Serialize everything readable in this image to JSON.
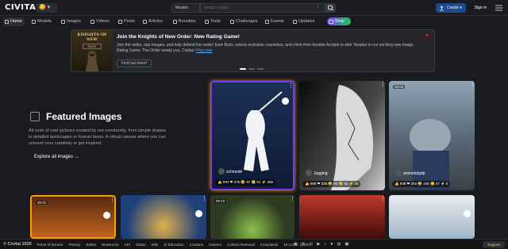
{
  "header": {
    "logo": "CIVITAI",
    "logo_badge": "😋 ▾",
    "search_select": "Models",
    "search_placeholder": "Search Civitai",
    "search_shortcut": "/",
    "create_label": "Create",
    "signin_label": "Sign In"
  },
  "nav": {
    "items": [
      {
        "label": "Home",
        "icon": "home-icon"
      },
      {
        "label": "Models",
        "icon": "models-icon"
      },
      {
        "label": "Images",
        "icon": "image-icon"
      },
      {
        "label": "Videos",
        "icon": "video-icon"
      },
      {
        "label": "Posts",
        "icon": "posts-icon"
      },
      {
        "label": "Articles",
        "icon": "article-icon"
      },
      {
        "label": "Bounties",
        "icon": "bounty-icon"
      },
      {
        "label": "Tools",
        "icon": "tools-icon"
      },
      {
        "label": "Challenges",
        "icon": "trophy-icon"
      },
      {
        "label": "Events",
        "icon": "calendar-icon"
      },
      {
        "label": "Updates",
        "icon": "updates-icon"
      }
    ],
    "shop_label": "Shop"
  },
  "banner": {
    "image_title": "KNIGHTS OF NEW",
    "image_sub": "RATE",
    "title": "Join the Knights of New Order: New Rating Game!",
    "body": "Join the ranks, rate images, and help defend the realm! Earn Buzz, unlock exclusive cosmetics, and climb from humble Acolyte to elite Templar in our exciting new Image Rating Game. The Order needs you, Civitan!",
    "link": "Play now",
    "button": "Find out more!"
  },
  "featured": {
    "title": "Featured Images",
    "description": "All sorts of cool pictures created by our community, from simple shapes to detailed landscapes or human faces. A virtual canvas where you can unleash your creativity or get inspired.",
    "explore_label": "Explore all images"
  },
  "cards": [
    {
      "user": "schmede",
      "stats": "👍 994  ❤ 376  😂 97  😢 51  ⚡ 255",
      "timer": ""
    },
    {
      "user": "Jogging",
      "stats": "👍 899  ❤ 335  😂 90  😢 63  ⚡ 25",
      "timer": ""
    },
    {
      "user": "animebdgdp",
      "stats": "👍 948  ❤ 264  😂 166  😢 47  ⚡ 5",
      "timer": "00:02"
    },
    {
      "user": "",
      "stats": "",
      "timer": "00:01"
    },
    {
      "user": "",
      "stats": "",
      "timer": ""
    },
    {
      "user": "",
      "stats": "",
      "timer": "00:10"
    },
    {
      "user": "",
      "stats": "",
      "timer": ""
    },
    {
      "user": "",
      "stats": "",
      "timer": ""
    }
  ],
  "footer": {
    "copyright": "© Civitai 2025",
    "links": [
      "Terms of Service",
      "Privacy",
      "Safety",
      "Newsroom",
      "API",
      "Status",
      "Wiki",
      "🎓Education",
      "Creators",
      "Careers",
      "Content Removal",
      "Complaints",
      "18 U.S.C. §2257"
    ],
    "socials": [
      "discord-icon",
      "x-icon",
      "instagram-icon",
      "youtube-icon",
      "tiktok-icon",
      "reddit-icon",
      "github-icon",
      "twitch-icon"
    ],
    "support_label": "Support"
  }
}
